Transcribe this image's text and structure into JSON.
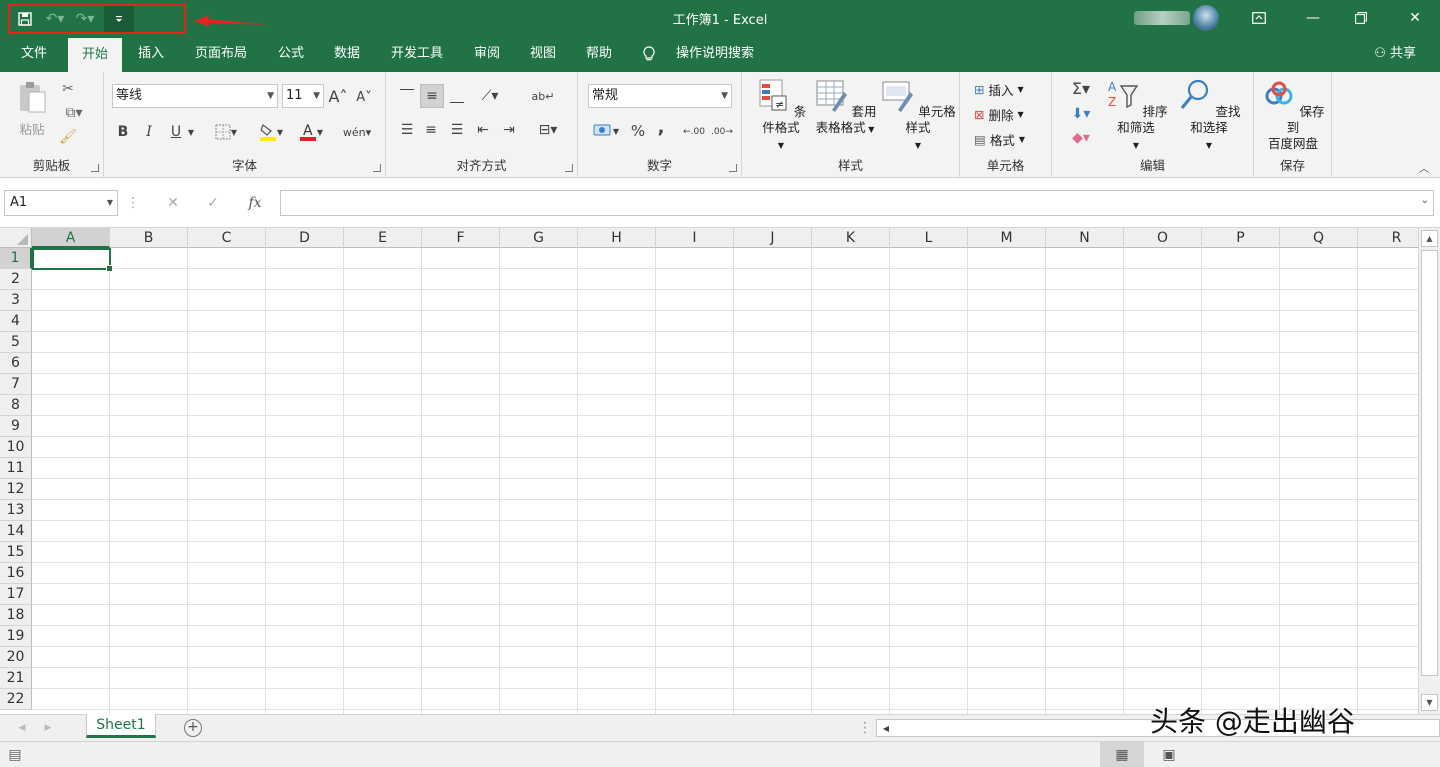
{
  "titlebar": {
    "title": "工作簿1  -  Excel",
    "qat": {
      "save": "save",
      "undo": "undo",
      "redo": "redo",
      "customize": "customize"
    }
  },
  "menu": {
    "tabs": [
      "文件",
      "开始",
      "插入",
      "页面布局",
      "公式",
      "数据",
      "开发工具",
      "审阅",
      "视图",
      "帮助"
    ],
    "active_tab": "开始",
    "tell_me": "操作说明搜索",
    "share": "共享"
  },
  "ribbon": {
    "clipboard": {
      "label": "剪贴板",
      "paste": "粘贴"
    },
    "font": {
      "label": "字体",
      "font_name": "等线",
      "font_size": "11",
      "bold": "B",
      "italic": "I",
      "underline": "U"
    },
    "alignment": {
      "label": "对齐方式"
    },
    "number": {
      "label": "数字",
      "format": "常规",
      "percent": "%",
      "comma": ",",
      "inc_decimal": ".00",
      "dec_decimal": ".00"
    },
    "styles": {
      "label": "样式",
      "conditional": "条件格式",
      "table_line1": "套用",
      "table_line2": "表格格式",
      "cell_styles": "单元格样式"
    },
    "cells": {
      "label": "单元格",
      "insert": "插入",
      "delete": "删除",
      "format": "格式"
    },
    "editing": {
      "label": "编辑",
      "sort": "排序和筛选",
      "find": "查找和选择"
    },
    "save": {
      "label": "保存",
      "line1": "保存到",
      "line2": "百度网盘"
    }
  },
  "formula_bar": {
    "name_box": "A1",
    "fx": "fx",
    "value": ""
  },
  "grid": {
    "columns": [
      "A",
      "B",
      "C",
      "D",
      "E",
      "F",
      "G",
      "H",
      "I",
      "J",
      "K",
      "L",
      "M",
      "N",
      "O",
      "P",
      "Q",
      "R"
    ],
    "rows": [
      "1",
      "2",
      "3",
      "4",
      "5",
      "6",
      "7",
      "8",
      "9",
      "10",
      "11",
      "12",
      "13",
      "14",
      "15",
      "16",
      "17",
      "18",
      "19",
      "20",
      "21",
      "22"
    ],
    "active_cell": "A1"
  },
  "sheets": {
    "tabs": [
      "Sheet1"
    ],
    "add": "+"
  },
  "watermark": "头条 @走出幽谷",
  "colors": {
    "accent": "#217346",
    "highlight_box": "#e8231a"
  }
}
